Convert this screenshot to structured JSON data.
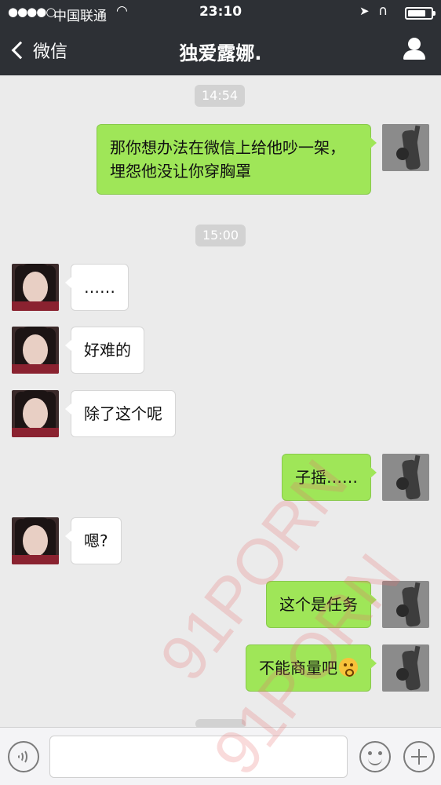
{
  "status_bar": {
    "signal": "●●●●○",
    "carrier": "中国联通",
    "time": "23:10",
    "battery_level": 0.8
  },
  "nav": {
    "back_label": "微信",
    "title": "独爱露娜."
  },
  "chat": {
    "timestamps": [
      "14:54",
      "15:00"
    ],
    "messages": [
      {
        "side": "out",
        "text": "那你想办法在微信上给他吵一架，埋怨他没让你穿胸罩"
      },
      {
        "side": "in",
        "text": "……"
      },
      {
        "side": "in",
        "text": "好难的"
      },
      {
        "side": "in",
        "text": "除了这个呢"
      },
      {
        "side": "out",
        "text": "子摇……"
      },
      {
        "side": "in",
        "text": "嗯?"
      },
      {
        "side": "out",
        "text": "这个是任务"
      },
      {
        "side": "out",
        "text": "不能商量吧",
        "emoji": "embarrassed-emoji"
      }
    ]
  },
  "watermark": [
    "91PORN",
    "91PORN"
  ],
  "colors": {
    "nav_bg": "#2d3035",
    "chat_bg": "#ebebeb",
    "out_bubble": "#9fe658",
    "in_bubble": "#ffffff"
  }
}
